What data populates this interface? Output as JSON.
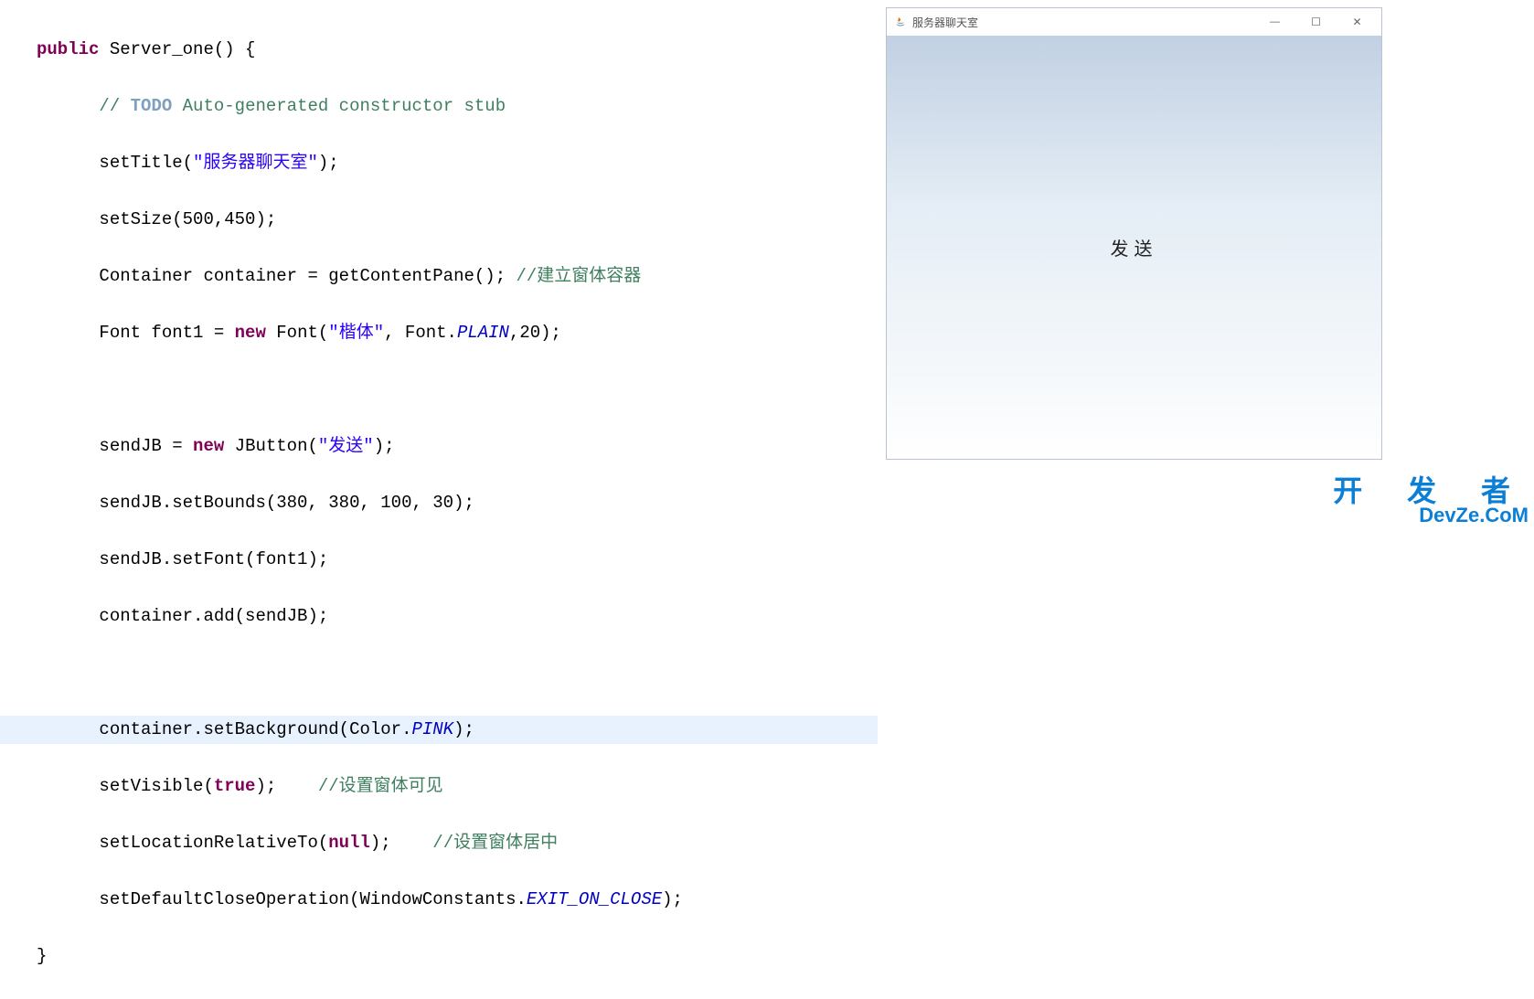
{
  "code": {
    "l1": {
      "kw": "public",
      "sig": " Server_one() {"
    },
    "l2": {
      "cm_pre": "// ",
      "todo": "TODO",
      "cm_rest": " Auto-generated constructor stub"
    },
    "l3": {
      "pre": "setTitle(",
      "str": "\"服务器聊天室\"",
      "post": ");"
    },
    "l4": "setSize(500,450);",
    "l5": {
      "pre": "Container container = getContentPane(); ",
      "cm": "//建立窗体容器"
    },
    "l6": {
      "pre": "Font font1 = ",
      "kw": "new",
      "mid": " Font(",
      "str": "\"楷体\"",
      "mid2": ", Font.",
      "ci": "PLAIN",
      "post": ",20);"
    },
    "l7": "",
    "l8": {
      "pre": "sendJB = ",
      "kw": "new",
      "mid": " JButton(",
      "str": "\"发送\"",
      "post": ");"
    },
    "l9": "sendJB.setBounds(380, 380, 100, 30);",
    "l10": "sendJB.setFont(font1);",
    "l11": "container.add(sendJB);",
    "l12": "",
    "l13": {
      "pre": "container.setBackground(Color.",
      "ci": "PINK",
      "post": ");"
    },
    "l14": {
      "pre": "setVisible(",
      "kw": "true",
      "mid": ");    ",
      "cm": "//设置窗体可见"
    },
    "l15": {
      "pre": "setLocationRelativeTo(",
      "kw": "null",
      "mid": ");    ",
      "cm": "//设置窗体居中"
    },
    "l16": {
      "pre": "setDefaultCloseOperation(WindowConstants.",
      "ci": "EXIT_ON_CLOSE",
      "post": ");"
    },
    "l17": "}"
  },
  "window": {
    "title": "服务器聊天室",
    "button_label": "发送"
  },
  "watermark": {
    "line1": "开 发 者",
    "line2": "DevZe.CoM"
  }
}
